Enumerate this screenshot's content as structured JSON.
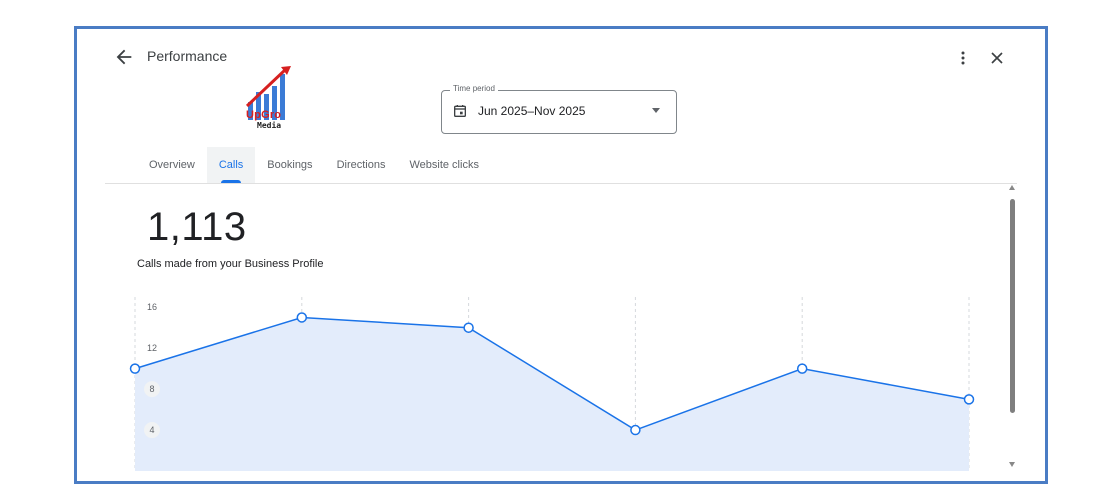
{
  "header": {
    "title": "Performance",
    "back_icon": "arrow-left-icon",
    "more_icon": "more-vert-icon",
    "close_icon": "close-icon"
  },
  "logo": {
    "name": "UpGro",
    "sub": "Media",
    "colors": [
      "#d62020",
      "#3b7bd6"
    ]
  },
  "time_period": {
    "label": "Time period",
    "value": "Jun 2025–Nov 2025",
    "icon": "calendar-icon"
  },
  "tabs": [
    {
      "label": "Overview",
      "active": false
    },
    {
      "label": "Calls",
      "active": true
    },
    {
      "label": "Bookings",
      "active": false
    },
    {
      "label": "Directions",
      "active": false
    },
    {
      "label": "Website clicks",
      "active": false
    }
  ],
  "metric": {
    "value": "1,113",
    "label": "Calls made from your Business Profile"
  },
  "colors": {
    "accent": "#1a73e8",
    "area_fill": "#e3ecfb",
    "frame_border": "#4a7cc4"
  },
  "chart_data": {
    "type": "area",
    "y_ticks": [
      16,
      12,
      8,
      4
    ],
    "ylim": [
      0,
      17
    ],
    "series": [
      {
        "values": [
          10,
          15,
          14,
          4,
          10,
          7
        ]
      }
    ],
    "grid": "vertical-dashed"
  }
}
